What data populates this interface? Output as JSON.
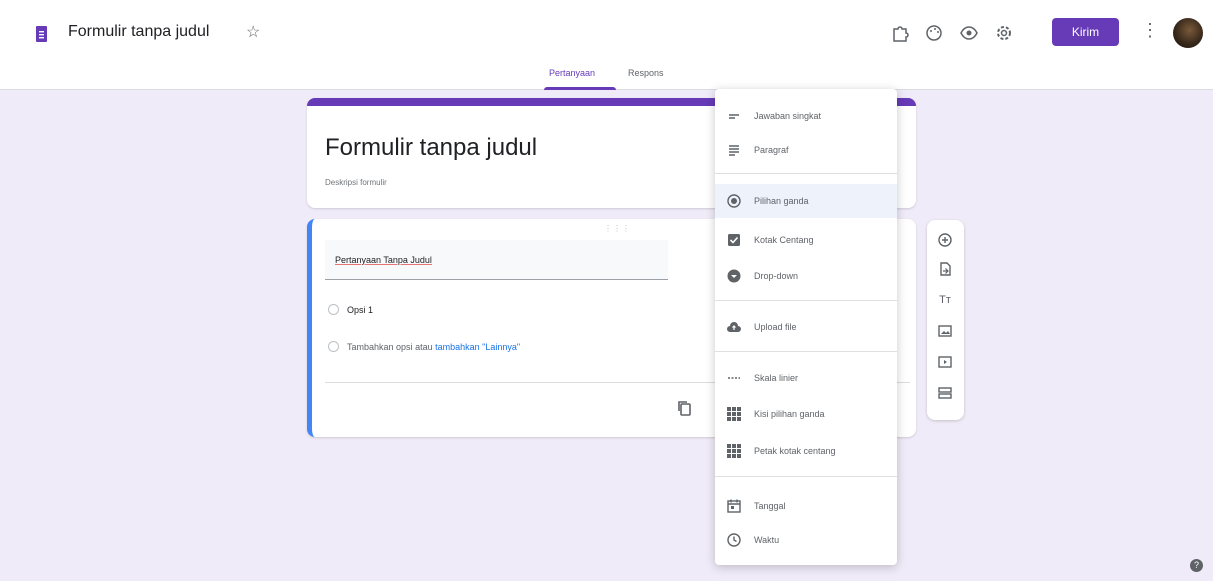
{
  "header": {
    "title": "Formulir tanpa judul",
    "send_label": "Kirim",
    "icons": [
      "palette-icon",
      "preview-icon",
      "settings-icon"
    ]
  },
  "tabs": [
    {
      "label": "Pertanyaan",
      "active": true
    },
    {
      "label": "Respons",
      "active": false
    }
  ],
  "form": {
    "title": "Formulir tanpa judul",
    "description": "Deskripsi formulir"
  },
  "question": {
    "title": "Pertanyaan Tanpa Judul",
    "options": [
      "Opsi 1"
    ],
    "add_option": "Tambahkan opsi",
    "or": "atau",
    "add_other": "tambahkan \"Lainnya\""
  },
  "menu": {
    "items": [
      {
        "label": "Jawaban singkat",
        "icon": "short-answer-icon"
      },
      {
        "label": "Paragraf",
        "icon": "paragraph-icon"
      },
      {
        "label": "Pilihan ganda",
        "icon": "radio-button-icon",
        "selected": true
      },
      {
        "label": "Kotak Centang",
        "icon": "checkbox-icon"
      },
      {
        "label": "Drop-down",
        "icon": "dropdown-icon"
      },
      {
        "label": "Upload file",
        "icon": "cloud-upload-icon"
      },
      {
        "label": "Skala linier",
        "icon": "linear-scale-icon"
      },
      {
        "label": "Kisi pilihan ganda",
        "icon": "grid-icon"
      },
      {
        "label": "Petak kotak centang",
        "icon": "checkbox-grid-icon"
      },
      {
        "label": "Tanggal",
        "icon": "calendar-icon"
      },
      {
        "label": "Waktu",
        "icon": "clock-icon"
      }
    ]
  },
  "colors": {
    "accent": "#673ab7",
    "background": "#f0ebf8",
    "question_border": "#4285f4"
  }
}
